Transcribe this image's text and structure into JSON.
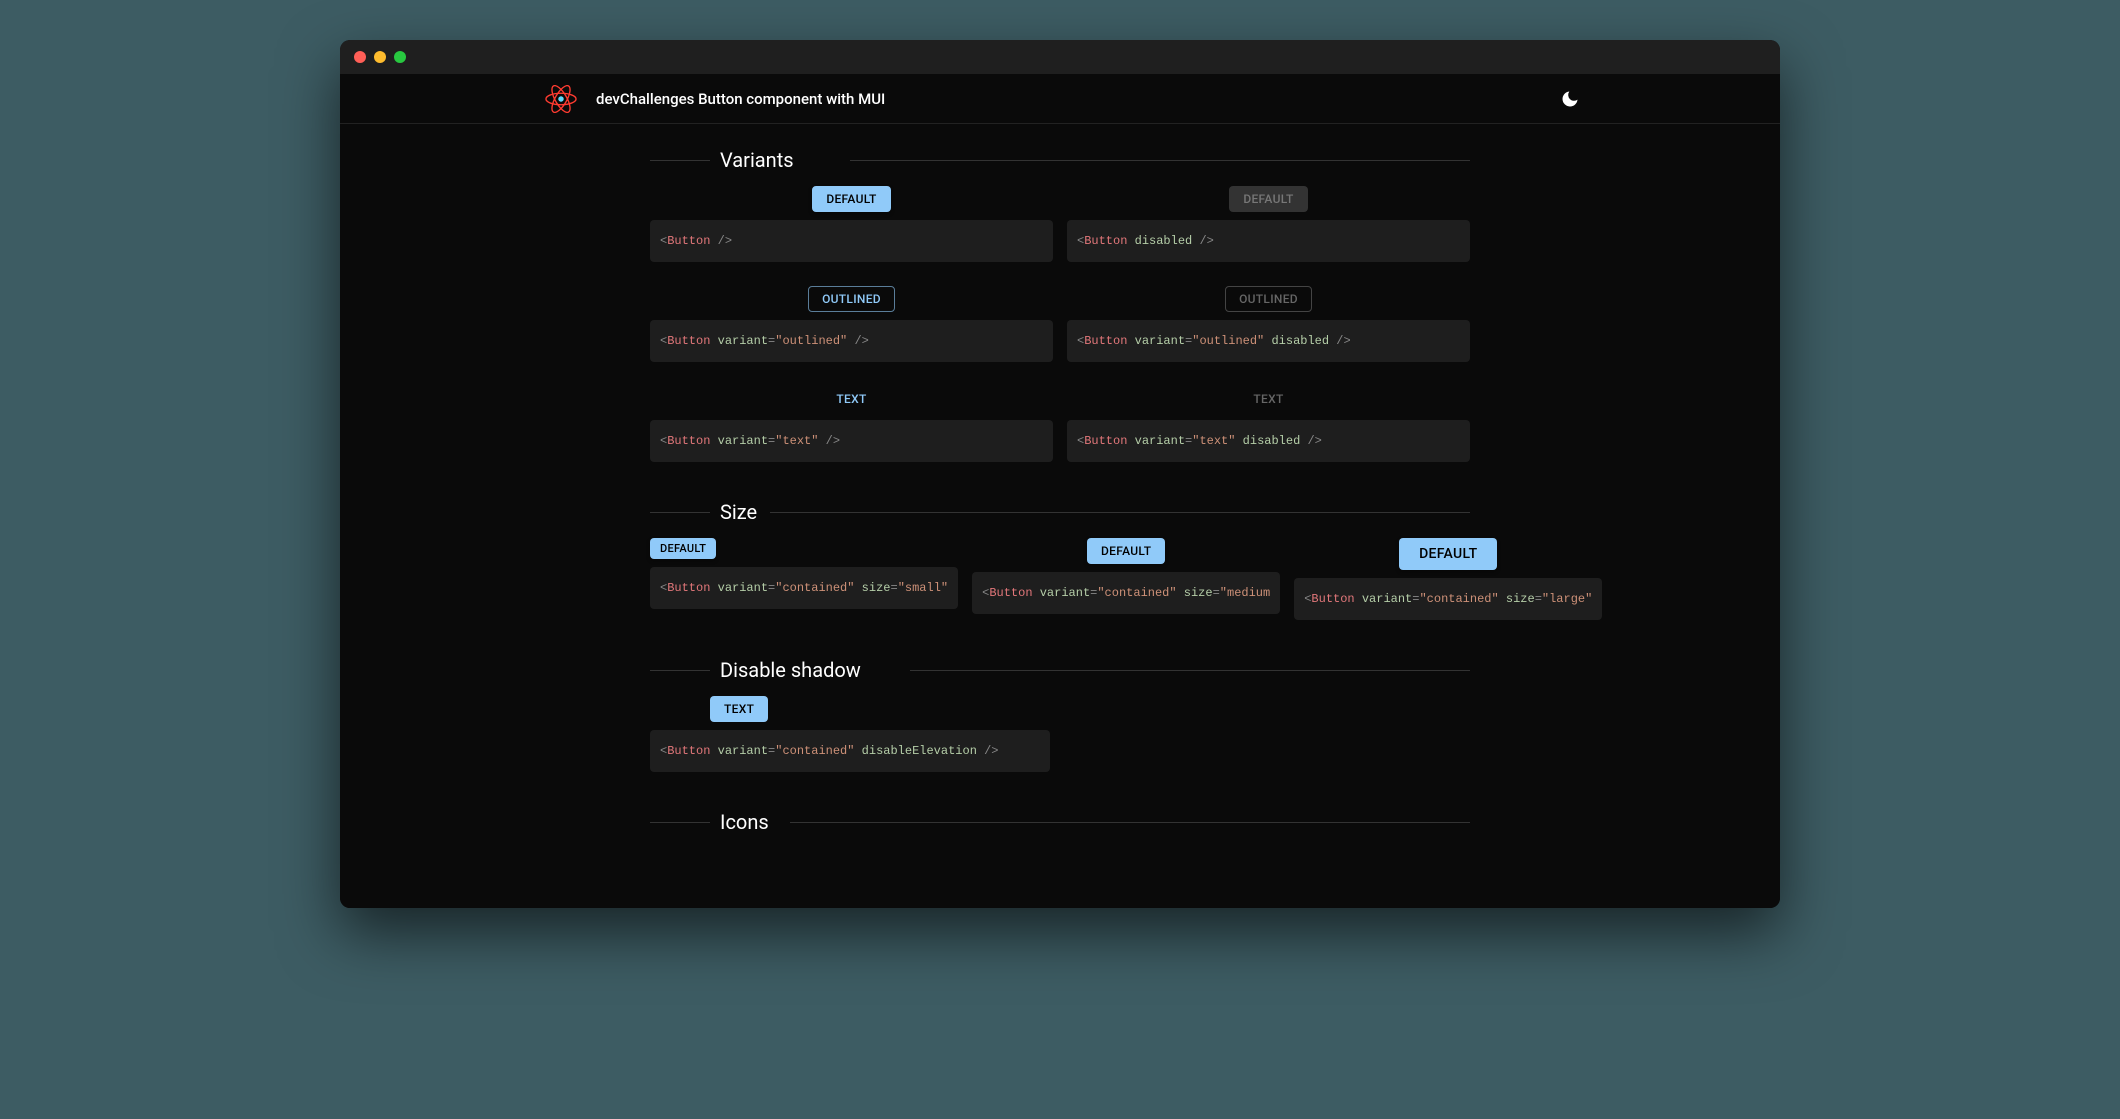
{
  "header": {
    "title": "devChallenges Button component with MUI"
  },
  "sections": {
    "variants": {
      "heading": "Variants",
      "rows": [
        {
          "a": {
            "label": "Default",
            "style": "contained",
            "code_html": "<span class='c-punc'>&lt;</span><span class='c-tag'>Button</span> <span class='c-punc'>/&gt;</span>"
          },
          "b": {
            "label": "Default",
            "style": "contained disabled",
            "code_html": "<span class='c-punc'>&lt;</span><span class='c-tag'>Button</span> <span class='c-attr'>disabled</span> <span class='c-punc'>/&gt;</span>"
          }
        },
        {
          "a": {
            "label": "Outlined",
            "style": "outlined",
            "code_html": "<span class='c-punc'>&lt;</span><span class='c-tag'>Button</span> <span class='c-attr'>variant</span><span class='c-eq'>=</span><span class='c-str'>&quot;outlined&quot;</span> <span class='c-punc'>/&gt;</span>"
          },
          "b": {
            "label": "Outlined",
            "style": "outlined disabled",
            "code_html": "<span class='c-punc'>&lt;</span><span class='c-tag'>Button</span> <span class='c-attr'>variant</span><span class='c-eq'>=</span><span class='c-str'>&quot;outlined&quot;</span> <span class='c-attr'>disabled</span> <span class='c-punc'>/&gt;</span>"
          }
        },
        {
          "a": {
            "label": "Text",
            "style": "text",
            "code_html": "<span class='c-punc'>&lt;</span><span class='c-tag'>Button</span> <span class='c-attr'>variant</span><span class='c-eq'>=</span><span class='c-str'>&quot;text&quot;</span> <span class='c-punc'>/&gt;</span>"
          },
          "b": {
            "label": "Text",
            "style": "text disabled",
            "code_html": "<span class='c-punc'>&lt;</span><span class='c-tag'>Button</span> <span class='c-attr'>variant</span><span class='c-eq'>=</span><span class='c-str'>&quot;text&quot;</span> <span class='c-attr'>disabled</span> <span class='c-punc'>/&gt;</span>"
          }
        }
      ]
    },
    "size": {
      "heading": "Size",
      "items": [
        {
          "label": "Default",
          "size": "small",
          "code_html": "<span class='c-punc'>&lt;</span><span class='c-tag'>Button</span> <span class='c-attr'>variant</span><span class='c-eq'>=</span><span class='c-str'>&quot;contained&quot;</span> <span class='c-attr'>size</span><span class='c-eq'>=</span><span class='c-str'>&quot;small&quot;</span>"
        },
        {
          "label": "Default",
          "size": "medium",
          "code_html": "<span class='c-punc'>&lt;</span><span class='c-tag'>Button</span> <span class='c-attr'>variant</span><span class='c-eq'>=</span><span class='c-str'>&quot;contained&quot;</span> <span class='c-attr'>size</span><span class='c-eq'>=</span><span class='c-str'>&quot;medium</span>"
        },
        {
          "label": "Default",
          "size": "large",
          "code_html": "<span class='c-punc'>&lt;</span><span class='c-tag'>Button</span> <span class='c-attr'>variant</span><span class='c-eq'>=</span><span class='c-str'>&quot;contained&quot;</span> <span class='c-attr'>size</span><span class='c-eq'>=</span><span class='c-str'>&quot;large&quot;</span>"
        }
      ]
    },
    "shadow": {
      "heading": "Disable shadow",
      "item": {
        "label": "Text",
        "code_html": "<span class='c-punc'>&lt;</span><span class='c-tag'>Button</span> <span class='c-attr'>variant</span><span class='c-eq'>=</span><span class='c-str'>&quot;contained&quot;</span> <span class='c-attr'>disableElevation</span> <span class='c-punc'>/&gt;</span>"
      }
    },
    "icons": {
      "heading": "Icons"
    }
  }
}
